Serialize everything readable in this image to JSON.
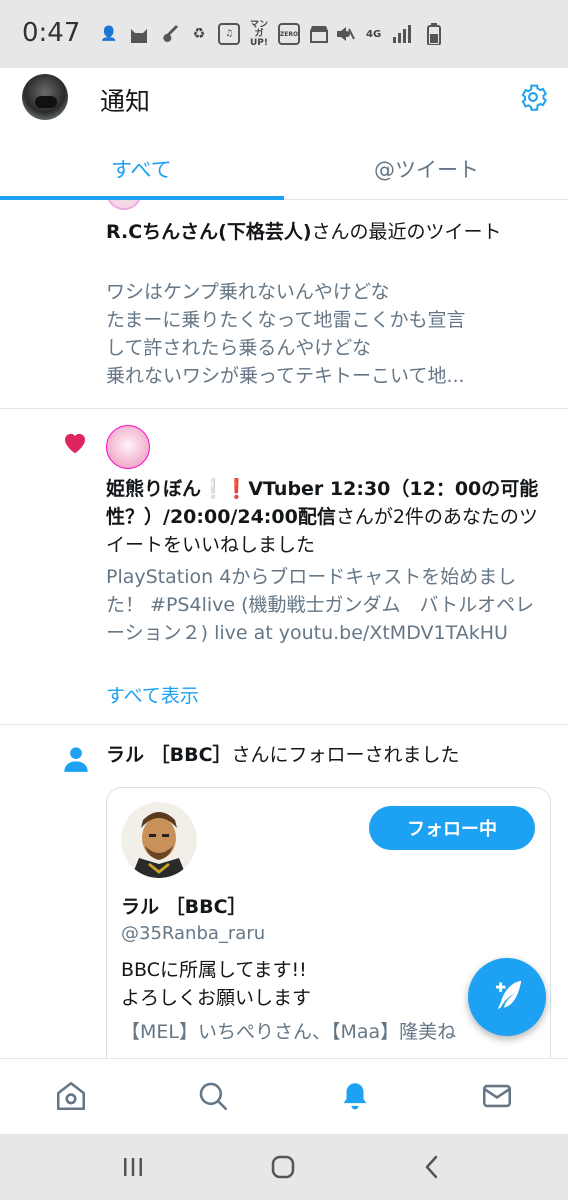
{
  "status_bar": {
    "time": "0:47",
    "icons": [
      "user-add-icon",
      "cat-icon",
      "guitar-icon",
      "recycle-icon",
      "music-icon",
      "manga-up-icon",
      "zero-icon",
      "store-icon",
      "dot-icon"
    ],
    "manga_label": "マンガ UP!",
    "zero_label": "ZERO",
    "network_label": "4G",
    "right_icons": [
      "mute-icon",
      "signal-icon",
      "battery-icon"
    ]
  },
  "header": {
    "title": "通知",
    "tabs": [
      {
        "label": "すべて",
        "active": true
      },
      {
        "label": "@ツイート",
        "active": false
      }
    ]
  },
  "notifications": [
    {
      "type": "recent_tweet",
      "user": "R.Cちんさん(下格芸人)",
      "text_suffix": "さんの最近のツイート",
      "quote_lines": [
        "ワシはケンプ乗れないんやけどな",
        "たまーに乗りたくなって地雷こくかも宣言",
        "して許されたら乗るんやけどな",
        "乗れないワシが乗ってテキトーこいて地..."
      ]
    },
    {
      "type": "like",
      "icon": "heart-icon",
      "user": "姫熊りぼん",
      "user_marks": "❕❗",
      "user_rest": "VTuber 12:30（12：00の可能性？）/20:00/24:00配信",
      "text_suffix": "さんが2件のあなたのツイートをいいねしました",
      "quote": "PlayStation 4からブロードキャストを始めました！ #PS4live (機動戦士ガンダム　バトルオペレーション２) live at youtu.be/XtMDV1TAkHU",
      "show_all": "すべて表示"
    },
    {
      "type": "follow",
      "icon": "person-icon",
      "user": "ラル ［BBC］",
      "text_suffix": "さんにフォローされました",
      "card": {
        "follow_button": "フォロー中",
        "name": "ラル ［BBC］",
        "handle": "@35Ranba_raru",
        "bio_lines": [
          "BBCに所属してます!!",
          "よろしくお願いします"
        ],
        "snippet": "【MEL】いちぺりさん、【Maa】隆美ね"
      }
    }
  ],
  "fab": {
    "icon": "compose-tweet-icon"
  },
  "bottom_nav": [
    {
      "name": "home-icon",
      "active": false
    },
    {
      "name": "search-icon",
      "active": false
    },
    {
      "name": "bell-icon",
      "active": true
    },
    {
      "name": "mail-icon",
      "active": false
    }
  ],
  "system_nav": [
    "recent-apps-icon",
    "home-circle-icon",
    "back-icon"
  ],
  "colors": {
    "accent": "#1da1f2",
    "text": "#14171a",
    "muted": "#657786",
    "like": "#e0245e",
    "divider": "#e1e8ed"
  }
}
